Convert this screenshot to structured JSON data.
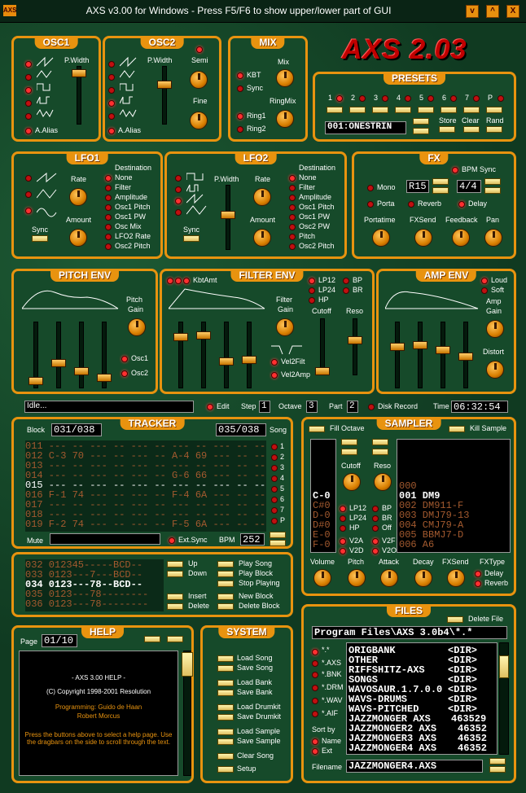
{
  "window": {
    "title": "AXS v3.00 for Windows - Press F5/F6 to show upper/lower part of GUI",
    "minimize": "v",
    "maximize": "^",
    "close": "X",
    "icon": "AXS"
  },
  "logo": "AXS 2.03",
  "osc1": {
    "title": "OSC1",
    "pwidth": "P.Width",
    "alias": "A.Alias"
  },
  "osc2": {
    "title": "OSC2",
    "pwidth": "P.Width",
    "semi": "Semi",
    "fine": "Fine",
    "alias": "A.Alias"
  },
  "mix": {
    "title": "MIX",
    "kbt": "KBT",
    "mix": "Mix",
    "sync": "Sync",
    "ringmix": "RingMix",
    "ring1": "Ring1",
    "ring2": "Ring2"
  },
  "presets": {
    "title": "PRESETS",
    "numbers": [
      "1",
      "2",
      "3",
      "4",
      "5",
      "6",
      "7",
      "P"
    ],
    "current": "001:ONESTRIN",
    "store": "Store",
    "clear": "Clear",
    "rand": "Rand"
  },
  "lfo1": {
    "title": "LFO1",
    "rate": "Rate",
    "amount": "Amount",
    "sync": "Sync",
    "destination": "Destination",
    "dests": [
      "None",
      "Filter",
      "Amplitude",
      "Osc1 Pitch",
      "Osc1 PW",
      "Osc Mix",
      "LFO2 Rate",
      "Osc2 Pitch"
    ]
  },
  "lfo2": {
    "title": "LFO2",
    "pwidth": "P.Width",
    "rate": "Rate",
    "amount": "Amount",
    "sync": "Sync",
    "destination": "Destination",
    "dests": [
      "None",
      "Filter",
      "Amplitude",
      "Osc1 Pitch",
      "Osc1 PW",
      "Osc2 PW",
      "Pitch",
      "Osc2 Pitch"
    ]
  },
  "fx": {
    "title": "FX",
    "mono": "Mono",
    "r": "R15",
    "time": "4/4",
    "bpmsync": "BPM Sync",
    "porta": "Porta",
    "reverb": "Reverb",
    "delay": "Delay",
    "portatime": "Portatime",
    "fxsend": "FXSend",
    "feedback": "Feedback",
    "pan": "Pan"
  },
  "pitchenv": {
    "title": "PITCH ENV",
    "pitch": "Pitch",
    "gain": "Gain",
    "osc1": "Osc1",
    "osc2": "Osc2"
  },
  "filterenv": {
    "title": "FILTER ENV",
    "kbtamt": "KbtAmt",
    "lp12": "LP12",
    "lp24": "LP24",
    "bp": "BP",
    "br": "BR",
    "hp": "HP",
    "filter": "Filter",
    "gain": "Gain",
    "cutoff": "Cutoff",
    "reso": "Reso",
    "vel2filt": "Vel2Filt",
    "vel2amp": "Vel2Amp"
  },
  "ampenv": {
    "title": "AMP ENV",
    "loud": "Loud",
    "soft": "Soft",
    "amp": "Amp",
    "gain": "Gain",
    "distort": "Distort"
  },
  "status": {
    "text": "Idle...",
    "edit": "Edit",
    "step": "Step",
    "step_val": "1",
    "octave": "Octave",
    "octave_val": "3",
    "part": "Part",
    "part_val": "2",
    "disk": "Disk Record",
    "time": "Time",
    "time_val": "06:32:54"
  },
  "tracker": {
    "title": "TRACKER",
    "block": "Block",
    "block_val": "031/038",
    "song_val": "035/038",
    "song": "Song",
    "rows": [
      "011 --- -- --- -- --- -- --- -- --- -- --- --",
      "012 C-3 70 --- -- --- -- A-4 69 --- -- --- --",
      "013 --- -- --- -- --- -- --- -- --- -- --- --",
      "014 --- -- --- -- --- -- G-6 66 --- -- --- --",
      "015 --- -- --- -- --- -- --- -- --- -- --- --",
      "016 F-1 74 --- -- --- -- F-4 6A --- -- --- --",
      "017 --- -- --- -- --- -- --- -- --- -- --- --",
      "018 --- -- --- -- --- -- --- -- --- -- --- --",
      "019 F-2 74 --- -- --- -- F-5 6A --- -- --- --"
    ],
    "current_row": 4,
    "track_nums": [
      "1",
      "2",
      "3",
      "4",
      "5",
      "6",
      "7",
      "P"
    ],
    "mute": "Mute",
    "extsync": "Ext.Sync",
    "bpm": "BPM",
    "bpm_val": "252"
  },
  "song": {
    "rows": [
      "032 012345-----BCD--",
      "033 0123---7---BCD--",
      "034 0123---78--BCD--",
      "035 0123---78--------",
      "036 0123---78--------"
    ],
    "current_row": 2,
    "buttons_left": [
      "Up",
      "Down",
      "Insert",
      "Delete"
    ],
    "buttons_right": [
      "Play Song",
      "Play Block",
      "Stop Playing",
      "New Block",
      "Delete Block"
    ]
  },
  "sampler": {
    "title": "SAMPLER",
    "filloctave": "Fill Octave",
    "killsample": "Kill Sample",
    "cutoff": "Cutoff",
    "reso": "Reso",
    "notes": [
      "C-0",
      "C#0",
      "D-0",
      "D#0",
      "E-0",
      "F-0"
    ],
    "samples": [
      "000",
      "001 DM9",
      "002 DM911-F",
      "003 DMJ79-13",
      "004 CMJ79-A",
      "005 BBMJ7-D",
      "006 A6"
    ],
    "current_sample": 1,
    "lp12": "LP12",
    "lp24": "LP24",
    "hp": "HP",
    "bp": "BP",
    "br": "BR",
    "off": "Off",
    "v2a": "V2A",
    "v2d": "V2D",
    "v2f": "V2F",
    "v2o": "V2O",
    "volume": "Volume",
    "pitch": "Pitch",
    "attack": "Attack",
    "decay": "Decay",
    "fxsend": "FXSend",
    "fxtype": "FXType",
    "delay": "Delay",
    "reverb": "Reverb"
  },
  "help": {
    "title": "HELP",
    "page": "Page",
    "page_val": "01/10",
    "line1": "- AXS 3.00 HELP -",
    "line2": "(C) Copyright 1998-2001 Resolution",
    "line3": "Programming: Guido de Haan",
    "line4": "Robert Morcus",
    "line5": "Press the buttons above to select a help page. Use the dragbars on the side to scroll through the text."
  },
  "system": {
    "title": "SYSTEM",
    "items": [
      "Load Song",
      "Save Song",
      "Load Bank",
      "Save Bank",
      "Load Drumkit",
      "Save Drumkit",
      "Load Sample",
      "Save Sample",
      "Clear Song",
      "Setup"
    ]
  },
  "files": {
    "title": "FILES",
    "deletefile": "Delete File",
    "path": "Program Files\\AXS 3.0b4\\*.*",
    "filters": [
      "*.*",
      "*.AXS",
      "*.BNK",
      "*.DRM",
      "*.WAV",
      "*.AIF"
    ],
    "sortby": "Sort by",
    "sort_name": "Name",
    "sort_ext": "Ext",
    "list": [
      [
        "ORIGBANK",
        "<DIR>"
      ],
      [
        "OTHER",
        "<DIR>"
      ],
      [
        "RIFFSHITZ-AXS",
        "<DIR>"
      ],
      [
        "SONGS",
        "<DIR>"
      ],
      [
        "WAVOSAUR.1.7.0.0",
        "<DIR>"
      ],
      [
        "WAVS-DRUMS",
        "<DIR>"
      ],
      [
        "WAVS-PITCHED",
        "<DIR>"
      ],
      [
        "JAZZMONGER AXS",
        "463529"
      ],
      [
        "JAZZMONGER2 AXS",
        "46352"
      ],
      [
        "JAZZMONGER3 AXS",
        "46352"
      ],
      [
        "JAZZMONGER4 AXS",
        "46352"
      ]
    ],
    "filename": "Filename",
    "filename_val": "JAZZMONGER4.AXS"
  },
  "colors": {
    "accent": "#e8930f",
    "bg": "#164a2a",
    "led": "#ff3030"
  }
}
